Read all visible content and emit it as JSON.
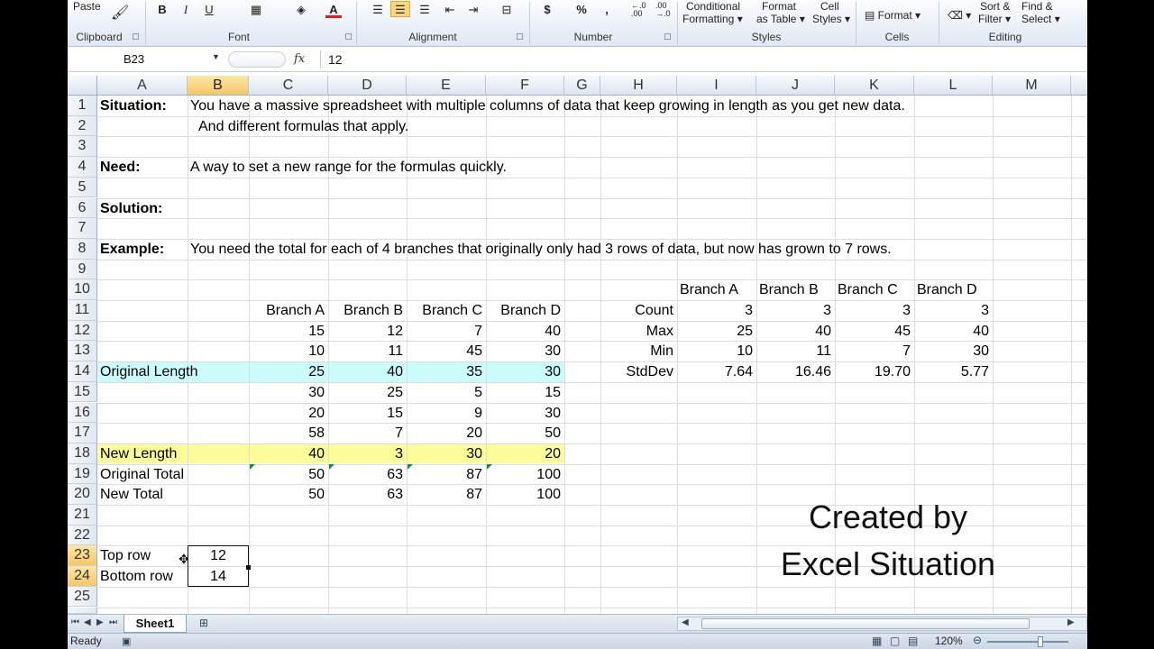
{
  "ribbon": {
    "clipboard": {
      "label": "Clipboard",
      "paste": "Paste"
    },
    "font": {
      "label": "Font",
      "bold": "B",
      "italic": "I",
      "underline": "U"
    },
    "alignment": {
      "label": "Alignment"
    },
    "number": {
      "label": "Number",
      "currency": "$",
      "percent": "%",
      "comma": ",",
      "inc_decimal": "←.0\n.00",
      "dec_decimal": ".00\n→.0"
    },
    "styles": {
      "label": "Styles",
      "conditional": "Conditional",
      "formatting": "Formatting",
      "format": "Format",
      "as_table": "as Table",
      "cell": "Cell",
      "cell_styles": "Styles"
    },
    "cells": {
      "label": "Cells",
      "format": "Format"
    },
    "editing": {
      "label": "Editing",
      "sort": "Sort &",
      "filter": "Filter",
      "find": "Find &",
      "select": "Select"
    }
  },
  "formula_bar": {
    "name_box": "B23",
    "fx": "fx",
    "value": "12"
  },
  "columns": [
    "A",
    "B",
    "C",
    "D",
    "E",
    "F",
    "G",
    "H",
    "I",
    "J",
    "K",
    "L",
    "M"
  ],
  "selected_column": "B",
  "rows": [
    "1",
    "2",
    "3",
    "4",
    "5",
    "6",
    "7",
    "8",
    "9",
    "10",
    "11",
    "12",
    "13",
    "14",
    "15",
    "16",
    "17",
    "18",
    "19",
    "20",
    "21",
    "22",
    "23",
    "24",
    "25"
  ],
  "selected_rows": [
    "23",
    "24"
  ],
  "text": {
    "situation_label": "Situation:",
    "situation_1": "You have a massive spreadsheet with multiple columns of data that keep growing in length as you get new data.",
    "situation_2": "And different formulas that apply.",
    "need_label": "Need:",
    "need": "A way to set a new range for the formulas quickly.",
    "solution_label": "Solution:",
    "example_label": "Example:",
    "example": "You need the total for each of 4 branches that originally only had 3 rows of data, but now has grown to 7 rows."
  },
  "table1": {
    "headers": [
      "Branch A",
      "Branch B",
      "Branch C",
      "Branch D"
    ],
    "rows": [
      {
        "label": "",
        "values": [
          "15",
          "12",
          "7",
          "40"
        ]
      },
      {
        "label": "",
        "values": [
          "10",
          "11",
          "45",
          "30"
        ]
      },
      {
        "label": "Original Length",
        "values": [
          "25",
          "40",
          "35",
          "30"
        ]
      },
      {
        "label": "",
        "values": [
          "30",
          "25",
          "5",
          "15"
        ]
      },
      {
        "label": "",
        "values": [
          "20",
          "15",
          "9",
          "30"
        ]
      },
      {
        "label": "",
        "values": [
          "58",
          "7",
          "20",
          "50"
        ]
      },
      {
        "label": "New Length",
        "values": [
          "40",
          "3",
          "30",
          "20"
        ]
      },
      {
        "label": "Original Total",
        "values": [
          "50",
          "63",
          "87",
          "100"
        ]
      },
      {
        "label": "New Total",
        "values": [
          "50",
          "63",
          "87",
          "100"
        ]
      }
    ]
  },
  "table2": {
    "headers": [
      "Branch A",
      "Branch B",
      "Branch C",
      "Branch D"
    ],
    "rows": [
      {
        "label": "Count",
        "values": [
          "3",
          "3",
          "3",
          "3"
        ]
      },
      {
        "label": "Max",
        "values": [
          "25",
          "40",
          "45",
          "40"
        ]
      },
      {
        "label": "Min",
        "values": [
          "10",
          "11",
          "7",
          "30"
        ]
      },
      {
        "label": "StdDev",
        "values": [
          "7.64",
          "16.46",
          "19.70",
          "5.77"
        ]
      }
    ]
  },
  "inputs": {
    "top_row_label": "Top row",
    "top_row_value": "12",
    "bottom_row_label": "Bottom row",
    "bottom_row_value": "14"
  },
  "watermark": {
    "line1": "Created by",
    "line2": "Excel Situation"
  },
  "sheet_tab": "Sheet1",
  "status": {
    "ready": "Ready",
    "zoom": "120%"
  },
  "colors": {
    "cyan_band": "#ccfbfb",
    "yellow_band": "#fcfc99",
    "selection_header": "#f6c766"
  }
}
